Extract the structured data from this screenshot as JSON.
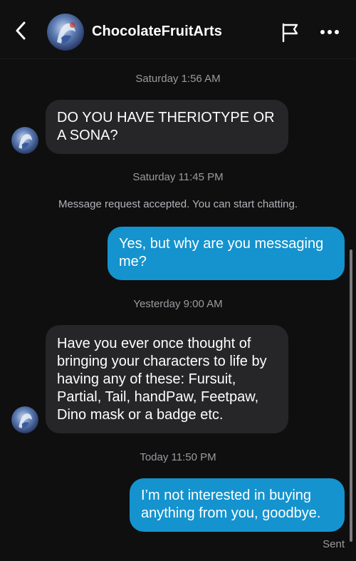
{
  "header": {
    "contact_name": "ChocolateFruitArts",
    "back_icon": "chevron-left-icon",
    "flag_icon": "flag-icon",
    "more_icon": "more-horizontal-icon"
  },
  "messages": {
    "ts1": "Saturday 1:56 AM",
    "m1": "DO YOU HAVE THERIOTYPE OR A SONA?",
    "ts2": "Saturday 11:45 PM",
    "notice": "Message request accepted. You can start chatting.",
    "m2": "Yes, but why are you messaging me?",
    "ts3": "Yesterday 9:00 AM",
    "m3": "Have you ever once thought of bringing your characters to life by having any of these: Fursuit, Partial, Tail, handPaw, Feetpaw, Dino mask or a badge etc.",
    "ts4": "Today 11:50 PM",
    "m4": "I’m not interested in buying anything from you, goodbye.",
    "status": "Sent"
  },
  "colors": {
    "background": "#0f0f10",
    "incoming_bubble": "#262628",
    "outgoing_bubble": "#1493ce",
    "muted_text": "#9b9ba0"
  }
}
